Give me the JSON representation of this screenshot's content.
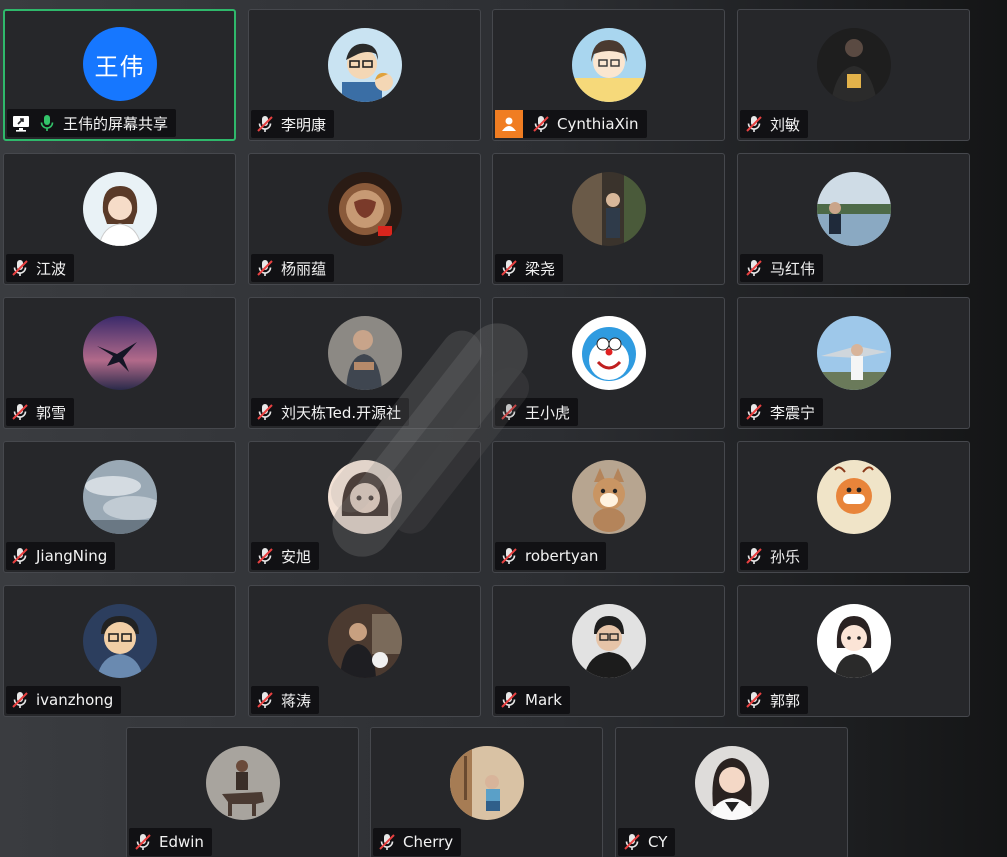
{
  "participants": [
    {
      "name": "王伟的屏幕共享",
      "initials": "王伟",
      "color": "#1677ff",
      "active": true,
      "mic": "on",
      "screen_share": true
    },
    {
      "name": "李明康",
      "mic": "muted",
      "color": "#c9e3f2"
    },
    {
      "name": "CynthiaXin",
      "mic": "muted",
      "badge": "user-icon",
      "color": "#f6d97a"
    },
    {
      "name": "刘敏",
      "mic": "muted",
      "color": "#1e1e1e"
    },
    {
      "name": "江波",
      "mic": "muted",
      "color": "#e9f2f6"
    },
    {
      "name": "杨丽蕴",
      "mic": "muted",
      "color": "#8a5a3a"
    },
    {
      "name": "梁尧",
      "mic": "muted",
      "color": "#5a4a3c"
    },
    {
      "name": "马红伟",
      "mic": "muted",
      "color": "#8aa9c2"
    },
    {
      "name": "郭雪",
      "mic": "muted",
      "color": "#6b4a8a"
    },
    {
      "name": "刘天栋Ted.开源社",
      "mic": "muted",
      "color": "#6d6a66"
    },
    {
      "name": "王小虎",
      "mic": "muted",
      "color": "#2f9be0"
    },
    {
      "name": "李震宁",
      "mic": "muted",
      "color": "#9ec8ea"
    },
    {
      "name": "JiangNing",
      "mic": "muted",
      "color": "#9aa9b5"
    },
    {
      "name": "安旭",
      "mic": "muted",
      "color": "#e6b9a3"
    },
    {
      "name": "robertyan",
      "mic": "muted",
      "color": "#b4845a"
    },
    {
      "name": "孙乐",
      "mic": "muted",
      "color": "#f0e4c8"
    },
    {
      "name": "ivanzhong",
      "mic": "muted",
      "color": "#2c3e5e"
    },
    {
      "name": "蒋涛",
      "mic": "muted",
      "color": "#4b3a30"
    },
    {
      "name": "Mark",
      "mic": "muted",
      "color": "#dcdcdc"
    },
    {
      "name": "郭郭",
      "mic": "muted",
      "color": "#ffffff"
    },
    {
      "name": "Edwin",
      "mic": "muted",
      "color": "#8c8680"
    },
    {
      "name": "Cherry",
      "mic": "muted",
      "color": "#c7a27a"
    },
    {
      "name": "CY",
      "mic": "muted",
      "color": "#d8d6d4"
    }
  ]
}
